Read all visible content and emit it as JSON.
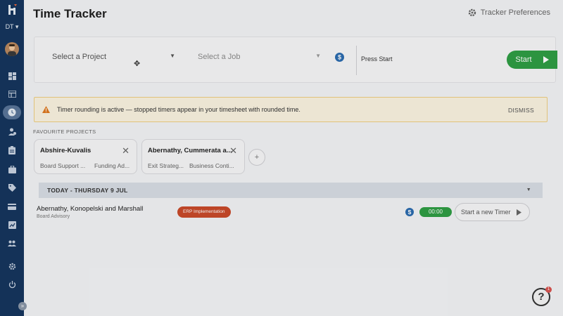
{
  "sidebar": {
    "user_initials": "DT ▾",
    "items": [
      {
        "icon": "dashboard-icon"
      },
      {
        "icon": "table-icon"
      },
      {
        "icon": "clock-icon",
        "active": true
      },
      {
        "icon": "person-icon"
      },
      {
        "icon": "clipboard-icon"
      },
      {
        "icon": "briefcase-icon"
      },
      {
        "icon": "tag-icon"
      },
      {
        "icon": "credit-card-icon"
      },
      {
        "icon": "chart-icon"
      },
      {
        "icon": "people-icon"
      },
      {
        "icon": "gear-icon"
      },
      {
        "icon": "power-icon"
      }
    ],
    "collapse_label": "»"
  },
  "header": {
    "title": "Time Tracker",
    "preferences_label": "Tracker Preferences"
  },
  "tracker": {
    "project_placeholder": "Select a Project",
    "job_placeholder": "Select a Job",
    "billable_symbol": "$",
    "description": "Press Start",
    "start_label": "Start"
  },
  "banner": {
    "message": "Timer rounding is active — stopped timers appear in your timesheet with rounded time.",
    "dismiss_label": "DISMISS"
  },
  "favourites": {
    "heading": "FAVOURITE PROJECTS",
    "cards": [
      {
        "name": "Abshire-Kuvalis",
        "jobs": [
          "Board Support ...",
          "Funding Ad..."
        ]
      },
      {
        "name": "Abernathy, Cummerata a...",
        "jobs": [
          "Exit Strateg...",
          "Business Conti..."
        ]
      }
    ],
    "add_label": "+"
  },
  "day": {
    "label": "TODAY - THURSDAY 9 JUL",
    "entries": [
      {
        "project": "Abernathy, Konopelski and Marshall",
        "job": "Board Advisory",
        "tag": "ERP Implementation",
        "billable_symbol": "$",
        "time": "00:00",
        "action_label": "Start a new Timer"
      }
    ]
  },
  "help": {
    "label": "?",
    "badge": "1"
  },
  "colors": {
    "sidebar": "#16365e",
    "start_green": "#2f9e44",
    "billable_blue": "#2b6cb0",
    "tag_red": "#c94a2a",
    "banner_bg": "#fbf4e1"
  }
}
